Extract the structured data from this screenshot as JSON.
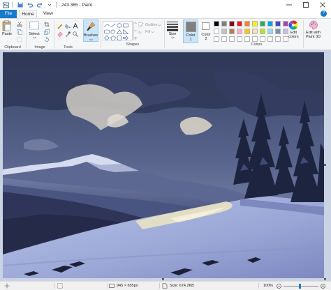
{
  "window": {
    "title": "243.365 - Paint",
    "quick_access": [
      "save-icon",
      "undo-icon",
      "redo-icon"
    ],
    "controls": [
      "minimize-icon",
      "maximize-icon",
      "close-icon"
    ]
  },
  "tabs": [
    {
      "label": "File"
    },
    {
      "label": "Home"
    },
    {
      "label": "View"
    }
  ],
  "ribbon": {
    "clipboard": {
      "label": "Clipboard",
      "paste_label": "Paste"
    },
    "image": {
      "label": "Image",
      "select_label": "Select"
    },
    "tools": {
      "label": "Tools"
    },
    "brushes": {
      "label": "Brushes"
    },
    "shapes": {
      "label": "Shapes",
      "outline_label": "Outline",
      "fill_label": "Fill"
    },
    "size": {
      "label": "Size"
    },
    "color1": {
      "label": "Color",
      "sub": "1"
    },
    "color2": {
      "label": "Color",
      "sub": "2"
    },
    "colors": {
      "label": "Colors",
      "edit_label": "Edit",
      "edit_sub": "colors"
    },
    "paint3d": {
      "label": "Edit with",
      "sub": "Paint 3D"
    }
  },
  "palette": [
    [
      "#000000",
      "#7f7f7f",
      "#880015",
      "#ed1c24",
      "#ff7f27",
      "#fff200",
      "#22b14c",
      "#00a2e8",
      "#3f48cc",
      "#a349a4"
    ],
    [
      "#ffffff",
      "#c3c3c3",
      "#b97a57",
      "#ffaec9",
      "#ffc90e",
      "#efe4b0",
      "#b5e61d",
      "#99d9ea",
      "#7092be",
      "#c8bfe7"
    ],
    [
      "#ffffff",
      "#ffffff",
      "#ffffff",
      "#ffffff",
      "#ffffff",
      "#ffffff",
      "#ffffff",
      "#ffffff",
      "#ffffff",
      "#ffffff"
    ]
  ],
  "colors_selected": {
    "color1": "#7f7f7f",
    "color2": "#ffffff"
  },
  "status": {
    "dimensions": "945 × 655px",
    "size": "Size: 674.2KB",
    "zoom": "100%"
  }
}
